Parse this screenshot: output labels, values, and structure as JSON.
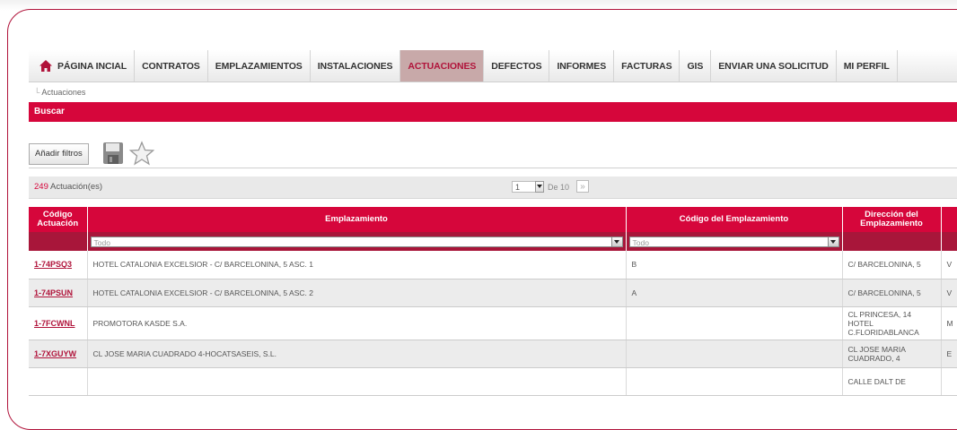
{
  "nav": {
    "items": [
      {
        "label": "PÁGINA INCIAL",
        "icon": "home-icon",
        "active": false
      },
      {
        "label": "CONTRATOS",
        "active": false
      },
      {
        "label": "EMPLAZAMIENTOS",
        "active": false
      },
      {
        "label": "INSTALACIONES",
        "active": false
      },
      {
        "label": "ACTUACIONES",
        "active": true
      },
      {
        "label": "DEFECTOS",
        "active": false
      },
      {
        "label": "INFORMES",
        "active": false
      },
      {
        "label": "FACTURAS",
        "active": false
      },
      {
        "label": "GIS",
        "active": false
      },
      {
        "label": "ENVIAR UNA SOLICITUD",
        "active": false
      },
      {
        "label": "MI PERFIL",
        "active": false
      }
    ]
  },
  "breadcrumb": "Actuaciones",
  "search_bar": "Buscar",
  "toolbar": {
    "add_filters": "Añadir filtros",
    "save_icon": "save-icon",
    "favorite_icon": "star-icon"
  },
  "pager": {
    "count": "249",
    "count_label": "Actuación(es)",
    "page": "1",
    "of_label": "De 10",
    "next": "»"
  },
  "table": {
    "columns": [
      "Código Actuación",
      "Emplazamiento",
      "Código del Emplazamiento",
      "Dirección del Emplazamiento",
      ""
    ],
    "filter_placeholder": "Todo",
    "rows": [
      {
        "code": "1-74PSQ3",
        "site": "HOTEL CATALONIA EXCELSIOR - C/ BARCELONINA, 5 ASC. 1",
        "site_code": "B",
        "address": "C/ BARCELONINA, 5",
        "extra": "V"
      },
      {
        "code": "1-74PSUN",
        "site": "HOTEL CATALONIA EXCELSIOR - C/ BARCELONINA, 5 ASC. 2",
        "site_code": "A",
        "address": "C/ BARCELONINA, 5",
        "extra": "V"
      },
      {
        "code": "1-7FCWNL",
        "site": "PROMOTORA KASDE S.A.",
        "site_code": "",
        "address": "CL PRINCESA, 14 HOTEL C.FLORIDABLANCA",
        "extra": "M"
      },
      {
        "code": "1-7XGUYW",
        "site": "CL JOSE MARIA CUADRADO 4-HOCATSASEIS, S.L.",
        "site_code": "",
        "address": "CL JOSE MARIA CUADRADO, 4",
        "extra": "E"
      },
      {
        "code": "",
        "site": "",
        "site_code": "",
        "address": "CALLE DALT DE",
        "extra": ""
      }
    ]
  },
  "colors": {
    "accent": "#d6063b",
    "dark_accent": "#a8163a",
    "frame": "#b0133a"
  }
}
